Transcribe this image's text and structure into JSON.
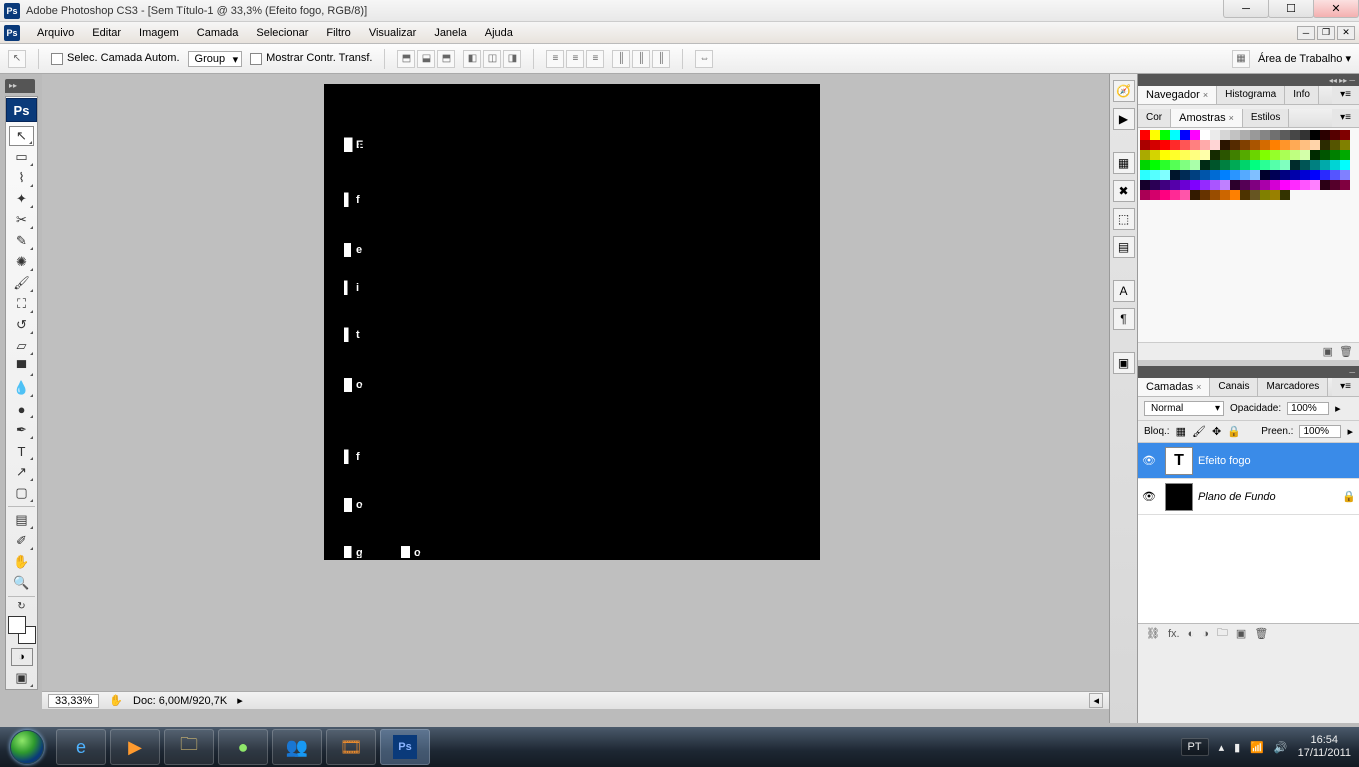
{
  "titlebar": {
    "title": "Adobe Photoshop CS3 - [Sem Título-1 @ 33,3% (Efeito fogo, RGB/8)]"
  },
  "menu": {
    "items": [
      "Arquivo",
      "Editar",
      "Imagem",
      "Camada",
      "Selecionar",
      "Filtro",
      "Visualizar",
      "Janela",
      "Ajuda"
    ]
  },
  "options": {
    "auto_select": "Selec. Camada Autom.",
    "group_mode": "Group",
    "show_transform": "Mostrar Contr. Transf.",
    "workspace": "Área de Trabalho"
  },
  "statusbar": {
    "zoom": "33,33%",
    "docinfo": "Doc: 6,00M/920,7K"
  },
  "nav_panel": {
    "tabs": [
      "Navegador",
      "Histograma",
      "Info"
    ]
  },
  "color_panel": {
    "tabs": [
      "Cor",
      "Amostras",
      "Estilos"
    ],
    "active": 1,
    "colors": [
      "#ff0000",
      "#ffff00",
      "#00ff00",
      "#00ffff",
      "#0000ff",
      "#ff00ff",
      "#ffffff",
      "#ebebeb",
      "#d6d6d6",
      "#c2c2c2",
      "#adadad",
      "#999999",
      "#858585",
      "#707070",
      "#5c5c5c",
      "#474747",
      "#333333",
      "#000000",
      "#2b0000",
      "#550000",
      "#800000",
      "#aa0000",
      "#d40000",
      "#ff0000",
      "#ff2a2a",
      "#ff5555",
      "#ff8080",
      "#ffaaaa",
      "#ffd5d5",
      "#2b1500",
      "#552b00",
      "#804000",
      "#aa5500",
      "#d46b00",
      "#ff8000",
      "#ff952a",
      "#ffaa55",
      "#ffbf80",
      "#ffd4aa",
      "#2b2b00",
      "#555500",
      "#808000",
      "#aaaa00",
      "#d4d400",
      "#ffff00",
      "#ffff2a",
      "#ffff55",
      "#ffff80",
      "#ffffaa",
      "#152b00",
      "#2b5500",
      "#408000",
      "#55aa00",
      "#6bd400",
      "#80ff00",
      "#95ff2a",
      "#aaff55",
      "#bfff80",
      "#d4ffaa",
      "#002b00",
      "#005500",
      "#008000",
      "#00aa00",
      "#00d400",
      "#00ff00",
      "#2aff2a",
      "#55ff55",
      "#80ff80",
      "#aaffaa",
      "#002b15",
      "#00552b",
      "#008040",
      "#00aa55",
      "#00d46b",
      "#00ff80",
      "#2aff95",
      "#55ffaa",
      "#80ffbf",
      "#002b2b",
      "#005555",
      "#008080",
      "#00aaaa",
      "#00d4d4",
      "#00ffff",
      "#2affff",
      "#55ffff",
      "#80ffff",
      "#00152b",
      "#002b55",
      "#004080",
      "#0055aa",
      "#006bd4",
      "#0080ff",
      "#2a95ff",
      "#55aaff",
      "#80bfff",
      "#00002b",
      "#000055",
      "#000080",
      "#0000aa",
      "#0000d4",
      "#0000ff",
      "#2a2aff",
      "#5555ff",
      "#8080ff",
      "#15002b",
      "#2b0055",
      "#400080",
      "#5500aa",
      "#6b00d4",
      "#8000ff",
      "#952aff",
      "#aa55ff",
      "#bf80ff",
      "#2b002b",
      "#550055",
      "#800080",
      "#aa00aa",
      "#d400d4",
      "#ff00ff",
      "#ff2aff",
      "#ff55ff",
      "#ff80ff",
      "#2b0015",
      "#55002b",
      "#800040",
      "#aa0055",
      "#d4006b",
      "#ff0080",
      "#ff2a95",
      "#ff55aa",
      "#331a00",
      "#663300",
      "#994d00",
      "#cc6600",
      "#ff8000",
      "#4d3300",
      "#665522",
      "#808000",
      "#998000",
      "#333300"
    ]
  },
  "layers_panel": {
    "tabs": [
      "Camadas",
      "Canais",
      "Marcadores"
    ],
    "active": 0,
    "blend_mode": "Normal",
    "opacity_label": "Opacidade:",
    "opacity": "100%",
    "lock_label": "Bloq.:",
    "fill_label": "Preen.:",
    "fill": "100%",
    "layers": [
      {
        "name": "Efeito fogo",
        "kind": "text",
        "selected": true,
        "locked": false
      },
      {
        "name": "Plano de Fundo",
        "kind": "bg",
        "selected": false,
        "locked": true
      }
    ]
  },
  "canvas_text": {
    "word1": "Efeito",
    "word2": "fogo"
  },
  "taskbar": {
    "lang": "PT",
    "time": "16:54",
    "date": "17/11/2011"
  }
}
